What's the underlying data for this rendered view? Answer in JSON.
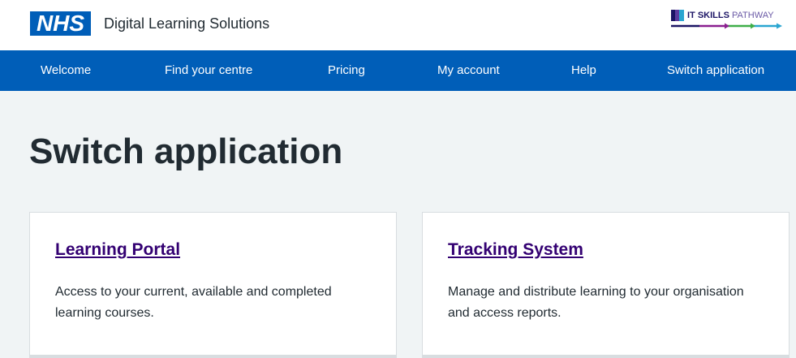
{
  "header": {
    "logo_text": "NHS",
    "service_name": "Digital Learning Solutions",
    "partner_logo_bold": "IT SKILLS",
    "partner_logo_light": "PATHWAY"
  },
  "nav": {
    "items": [
      {
        "label": "Welcome"
      },
      {
        "label": "Find your centre"
      },
      {
        "label": "Pricing"
      },
      {
        "label": "My account"
      },
      {
        "label": "Help"
      },
      {
        "label": "Switch application"
      }
    ]
  },
  "main": {
    "title": "Switch application",
    "cards": [
      {
        "title": "Learning Portal",
        "description": "Access to your current, available and completed learning courses."
      },
      {
        "title": "Tracking System",
        "description": "Manage and distribute learning to your organisation and access reports."
      }
    ]
  },
  "colors": {
    "nhs_blue": "#005eb8",
    "background": "#f0f4f5",
    "link_visited": "#330072",
    "text": "#212b32"
  }
}
